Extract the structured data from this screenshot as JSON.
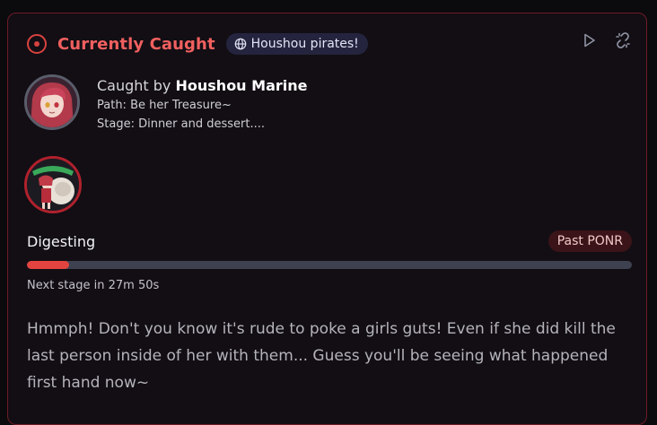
{
  "header": {
    "title": "Currently Caught",
    "world_tag": "Houshou pirates!"
  },
  "predator": {
    "caught_prefix": "Caught by",
    "name": "Houshou Marine",
    "path": "Path: Be her Treasure~",
    "stage": "Stage: Dinner and dessert...."
  },
  "status": {
    "label": "Digesting",
    "badge": "Past PONR",
    "progress_percent": 7,
    "next_stage": "Next stage in 27m 50s"
  },
  "message": "Hmmph! Don't you know it's rude to poke a girls guts! Even if she did kill the last person inside of her with them... Guess you'll be seeing what happened first hand now~",
  "colors": {
    "accent": "#f0605f",
    "progress_fill": "#e4443f",
    "progress_track": "#3e4250",
    "card_border": "#6e1c27",
    "badge_bg": "#3a1418",
    "chip_bg": "#25243f"
  },
  "icons": {
    "header": "target-icon",
    "world": "globe-icon",
    "play": "play-icon",
    "unlink": "broken-link-icon"
  }
}
